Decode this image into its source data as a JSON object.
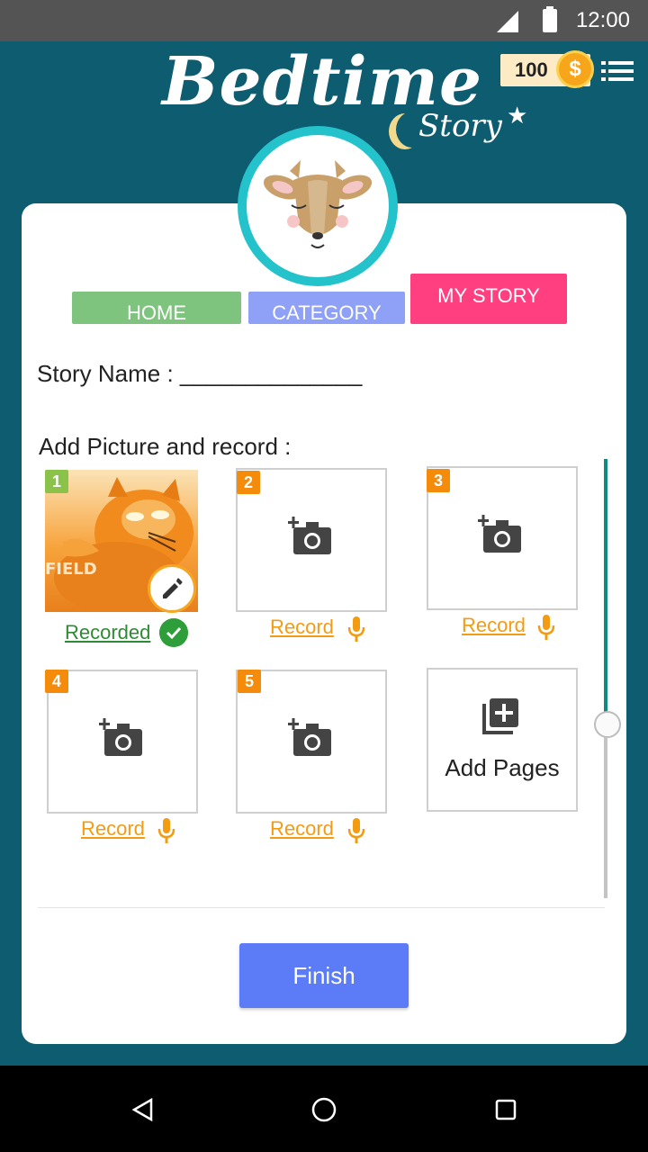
{
  "status_bar": {
    "time": "12:00"
  },
  "header": {
    "logo_title": "Bedtime",
    "logo_subtitle": "Story",
    "coins": "100",
    "coin_symbol": "$"
  },
  "tabs": {
    "home": "HOME",
    "category": "CATEGORY",
    "my_story": "MY STORY"
  },
  "form": {
    "story_name_label": "Story Name : ______________",
    "add_picture_label": "Add Picture and record :"
  },
  "pages": [
    {
      "number": "1",
      "status": "Recorded"
    },
    {
      "number": "2",
      "status": "Record"
    },
    {
      "number": "3",
      "status": "Record"
    },
    {
      "number": "4",
      "status": "Record"
    },
    {
      "number": "5",
      "status": "Record"
    }
  ],
  "photo_caption": "FIELD",
  "add_pages_label": "Add Pages",
  "finish_label": "Finish",
  "colors": {
    "background": "#0d5c70",
    "tab_home": "#7fc47e",
    "tab_category": "#8fa0f7",
    "tab_my_story": "#ff3f7f",
    "badge": "#f58b0a",
    "record_link": "#f39c12",
    "recorded_link": "#2e8b35",
    "finish_button": "#5b7cf6"
  },
  "icons": [
    "signal-icon",
    "battery-icon",
    "coin-icon",
    "menu-icon",
    "camera-add-icon",
    "mic-icon",
    "check-icon",
    "edit-icon",
    "add-pages-icon",
    "nav-back-icon",
    "nav-home-icon",
    "nav-recents-icon"
  ]
}
